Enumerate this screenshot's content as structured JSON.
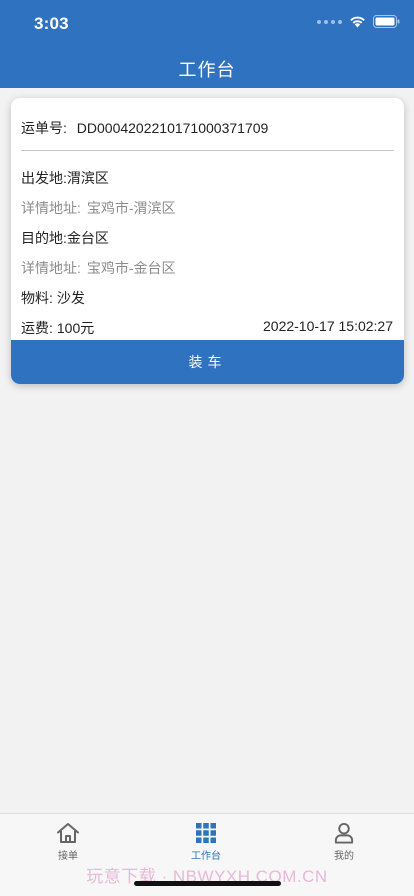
{
  "status_bar": {
    "time": "3:03"
  },
  "nav": {
    "title": "工作台"
  },
  "order": {
    "number_label": "运单号:",
    "number_value": "DD00042022101710003717​09",
    "origin_label": "出发地:",
    "origin_value": "渭滨区",
    "origin_detail_label": "详情地址:",
    "origin_detail_value": "宝鸡市-渭滨区",
    "dest_label": "目的地:",
    "dest_value": "金台区",
    "dest_detail_label": "详情地址:",
    "dest_detail_value": "宝鸡市-金台区",
    "material_label": "物料:",
    "material_value": "沙发",
    "fee_label": "运费:",
    "fee_value": "100元",
    "datetime": "2022-10-17 15:02:27",
    "action_label": "装车"
  },
  "tabs": [
    {
      "label": "接单",
      "icon": "home-icon",
      "active": false
    },
    {
      "label": "工作台",
      "icon": "grid-icon",
      "active": true
    },
    {
      "label": "我的",
      "icon": "person-icon",
      "active": false
    }
  ],
  "watermark": "玩意下载 · NBWYXH.COM.CN",
  "colors": {
    "primary": "#2f72c0",
    "background": "#f2f2f2",
    "muted_text": "#8c8c8c"
  }
}
